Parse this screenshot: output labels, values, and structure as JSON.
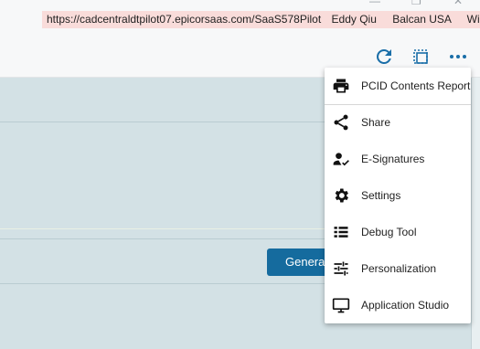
{
  "window_controls": {
    "minimize": "—",
    "restore": "❐",
    "close": "✕"
  },
  "env_bar": {
    "url": "https://cadcentraldtpilot07.epicorsaas.com/SaaS578Pilot",
    "user": "Eddy Qiu",
    "company": "Balcan USA",
    "site": "Wisconsin"
  },
  "toolbar": {
    "icons": [
      "refresh-icon",
      "select-frame-icon",
      "more-options-icon"
    ],
    "accent_color": "#1a6ea8"
  },
  "main": {
    "generate_button_label": "Generate"
  },
  "menu": {
    "items": [
      {
        "label": "PCID Contents Report",
        "icon": "print-icon"
      },
      {
        "label": "Share",
        "icon": "share-icon"
      },
      {
        "label": "E-Signatures",
        "icon": "signature-icon"
      },
      {
        "label": "Settings",
        "icon": "gear-icon"
      },
      {
        "label": "Debug Tool",
        "icon": "list-icon"
      },
      {
        "label": "Personalization",
        "icon": "sliders-icon"
      },
      {
        "label": "Application Studio",
        "icon": "monitor-icon"
      }
    ]
  }
}
